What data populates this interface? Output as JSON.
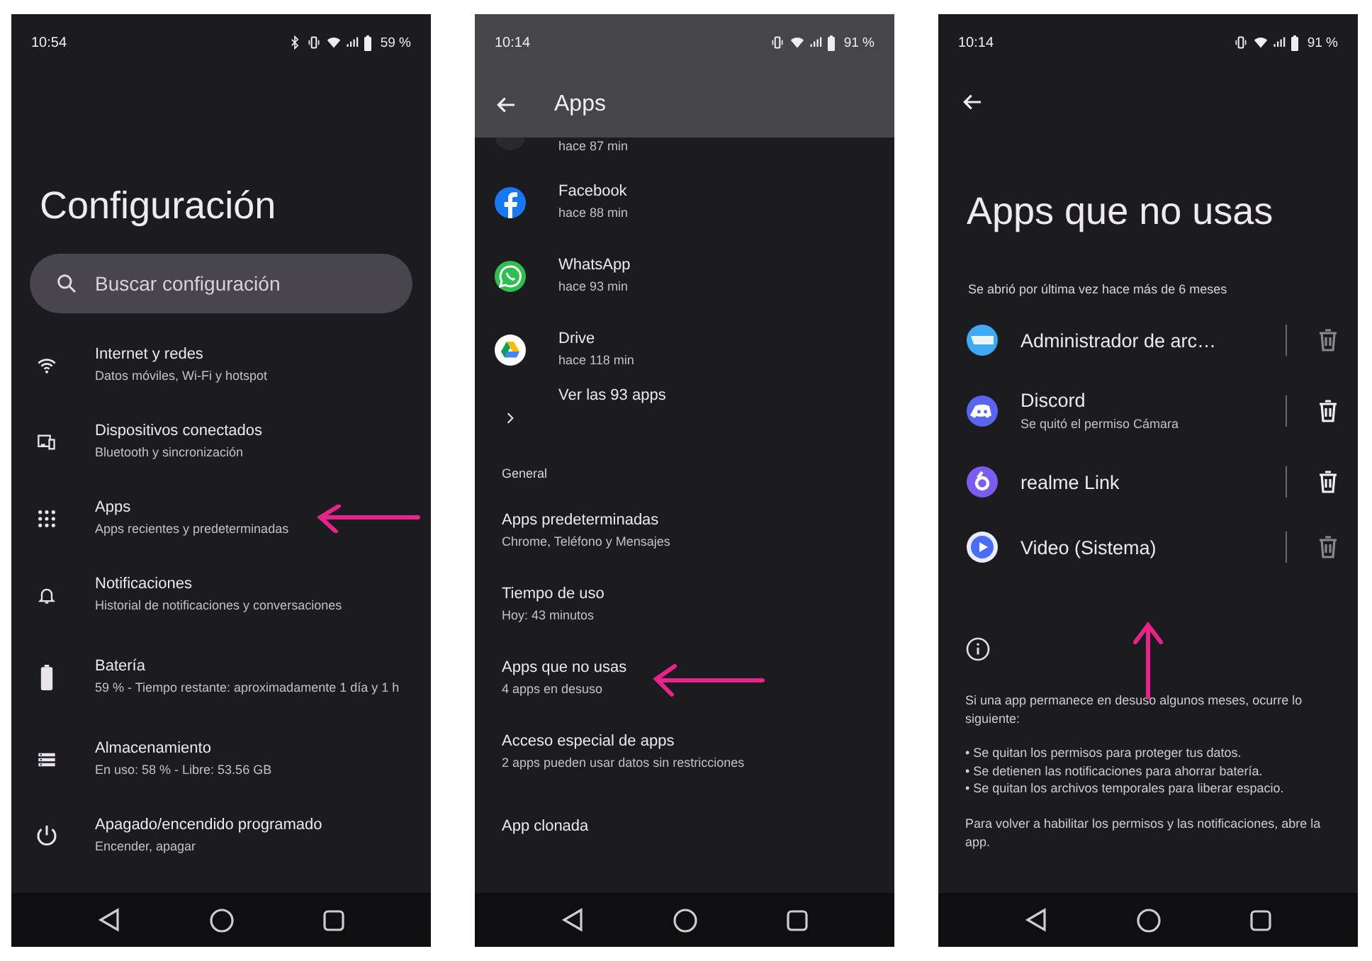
{
  "settings_screen": {
    "status_bar": {
      "time": "10:54",
      "battery": "59 %"
    },
    "title": "Configuración",
    "search": {
      "placeholder": "Buscar configuración"
    },
    "items": [
      {
        "title": "Internet y redes",
        "subtitle": "Datos móviles, Wi-Fi y hotspot"
      },
      {
        "title": "Dispositivos conectados",
        "subtitle": "Bluetooth y sincronización"
      },
      {
        "title": "Apps",
        "subtitle": "Apps recientes y predeterminadas"
      },
      {
        "title": "Notificaciones",
        "subtitle": "Historial de notificaciones y conversaciones"
      },
      {
        "title": "Batería",
        "subtitle": "59 % - Tiempo restante: aproximadamente 1 día y 1 h"
      },
      {
        "title": "Almacenamiento",
        "subtitle": "En uso: 58 % - Libre: 53.56 GB"
      },
      {
        "title": "Apagado/encendido programado",
        "subtitle": "Encender, apagar"
      }
    ]
  },
  "apps_screen": {
    "status_bar": {
      "time": "10:14",
      "battery": "91 %"
    },
    "title": "Apps",
    "recent_apps": [
      {
        "subtitle": "hace 87 min"
      },
      {
        "name": "Facebook",
        "subtitle": "hace 88 min"
      },
      {
        "name": "WhatsApp",
        "subtitle": "hace 93 min"
      },
      {
        "name": "Drive",
        "subtitle": "hace 118 min"
      }
    ],
    "see_all": "Ver las 93 apps",
    "section_title": "General",
    "items": [
      {
        "title": "Apps predeterminadas",
        "subtitle": "Chrome, Teléfono y Mensajes"
      },
      {
        "title": "Tiempo de uso",
        "subtitle": "Hoy: 43 minutos"
      },
      {
        "title": "Apps que no usas",
        "subtitle": "4 apps en desuso"
      },
      {
        "title": "Acceso especial de apps",
        "subtitle": "2 apps pueden usar datos sin restricciones"
      },
      {
        "title": "App clonada"
      }
    ]
  },
  "unused_apps_screen": {
    "status_bar": {
      "time": "10:14",
      "battery": "91 %"
    },
    "title": "Apps que no usas",
    "section_title": "Se abrió por última vez hace más de 6 meses",
    "apps": [
      {
        "name": "Administrador de arc…",
        "disabled": true
      },
      {
        "name": "Discord",
        "subtitle": "Se quitó el permiso Cámara",
        "disabled": false
      },
      {
        "name": "realme Link",
        "disabled": false
      },
      {
        "name": "Video (Sistema)",
        "disabled": true
      }
    ],
    "info": {
      "intro": "Si una app permanece en desuso algunos meses, ocurre lo siguiente:",
      "bullets": [
        "• Se quitan los permisos para proteger tus datos.",
        "• Se detienen las notificaciones para ahorrar batería.",
        "• Se quitan los archivos temporales para liberar espacio."
      ],
      "outro": "Para volver a habilitar los permisos y las notificaciones, abre la app."
    }
  }
}
